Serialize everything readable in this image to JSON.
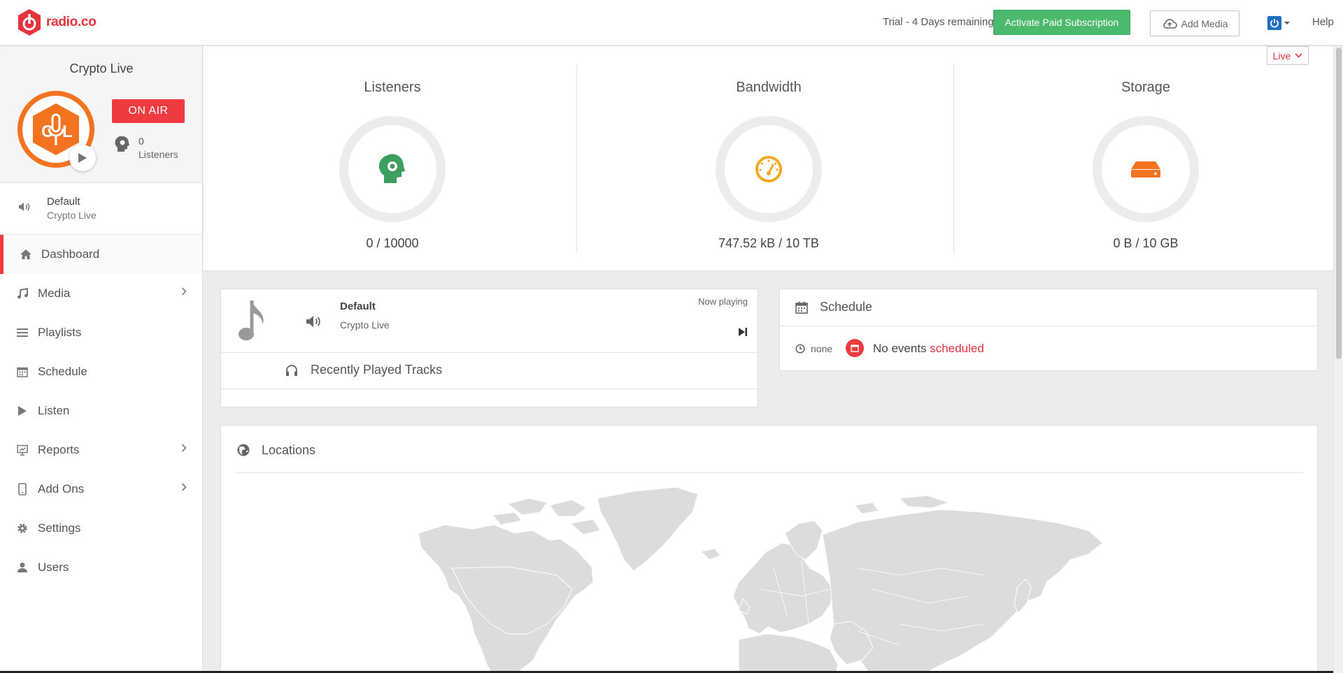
{
  "brand": {
    "name": "radio.co",
    "color": "#e8323c"
  },
  "topbar": {
    "trial_text": "Trial - 4 Days remaining",
    "activate_label": "Activate Paid Subscription",
    "add_media_label": "Add Media",
    "help_label": "Help"
  },
  "station": {
    "name": "Crypto Live",
    "on_air_label": "ON AIR",
    "listeners_count": "0",
    "listeners_label": "Listeners",
    "art_color": "#f37321"
  },
  "stream": {
    "title": "Default",
    "subtitle": "Crypto Live"
  },
  "nav": [
    {
      "label": "Dashboard",
      "icon": "home-icon",
      "active": true
    },
    {
      "label": "Media",
      "icon": "music-note-icon",
      "has_submenu": true
    },
    {
      "label": "Playlists",
      "icon": "list-icon"
    },
    {
      "label": "Schedule",
      "icon": "calendar-icon"
    },
    {
      "label": "Listen",
      "icon": "play-icon"
    },
    {
      "label": "Reports",
      "icon": "presentation-icon",
      "has_submenu": true
    },
    {
      "label": "Add Ons",
      "icon": "mobile-icon",
      "has_submenu": true
    },
    {
      "label": "Settings",
      "icon": "gear-icon"
    },
    {
      "label": "Users",
      "icon": "user-icon"
    }
  ],
  "stats": {
    "listeners": {
      "title": "Listeners",
      "value": "0 / 10000",
      "color": "#3c9e5f"
    },
    "bandwidth": {
      "title": "Bandwidth",
      "value": "747.52 kB / 10 TB",
      "color": "#f5a623"
    },
    "storage": {
      "title": "Storage",
      "value": "0 B / 10 GB",
      "color": "#f37321"
    }
  },
  "live_dropdown": {
    "label": "Live"
  },
  "now_playing": {
    "title": "Default",
    "subtitle": "Crypto Live",
    "label": "Now playing",
    "recent_title": "Recently Played Tracks"
  },
  "schedule": {
    "title": "Schedule",
    "none_label": "none",
    "msg_prefix": "No events",
    "msg_highlight": "scheduled"
  },
  "locations": {
    "title": "Locations"
  }
}
